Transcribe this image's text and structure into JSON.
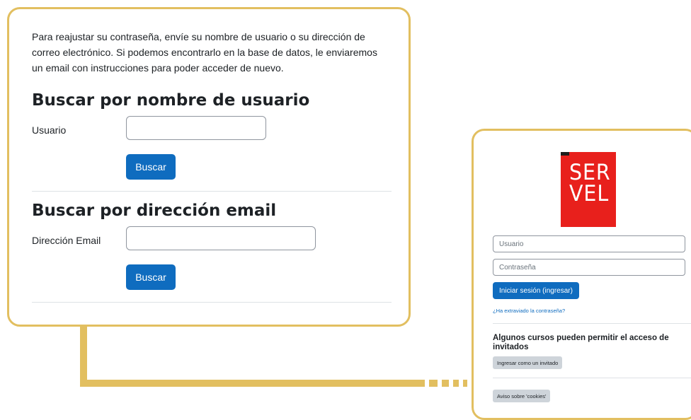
{
  "forgot": {
    "intro": "Para reajustar su contraseña, envíe su nombre de usuario o su dirección de correo electrónico. Si podemos encontrarlo en la base de datos, le enviaremos un email con instrucciones para poder acceder de nuevo.",
    "username_section": {
      "title": "Buscar por nombre de usuario",
      "label": "Usuario",
      "value": "",
      "button": "Buscar"
    },
    "email_section": {
      "title": "Buscar por dirección email",
      "label": "Dirección Email",
      "value": "",
      "button": "Buscar"
    }
  },
  "login": {
    "logo_lines": [
      "SER",
      "VEL"
    ],
    "username_placeholder": "Usuario",
    "password_placeholder": "Contraseña",
    "login_button": "Iniciar sesión (ingresar)",
    "forgot_link": "¿Ha extraviado la contraseña?",
    "guest_title": "Algunos cursos pueden permitir el acceso de invitados",
    "guest_button": "Ingresar como un invitado",
    "cookies_button": "Aviso sobre 'cookies'"
  },
  "colors": {
    "frame": "#e2bf60",
    "primary": "#0f6cbf",
    "logo_red": "#e8201c"
  }
}
